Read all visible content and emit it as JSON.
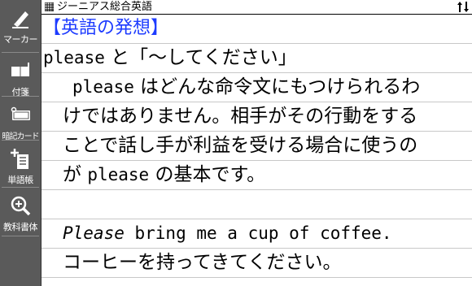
{
  "toolbar": {
    "items": [
      {
        "label": "マーカー",
        "icon": "marker-pen-icon"
      },
      {
        "label": "付箋",
        "icon": "sticky-note-icon"
      },
      {
        "label": "暗記カード",
        "icon": "flashcard-icon"
      },
      {
        "label": "単語帳",
        "icon": "wordbook-add-icon"
      },
      {
        "label": "教科書体",
        "icon": "zoom-icon"
      }
    ]
  },
  "title_bar": {
    "title": "ジーニアス総合英語"
  },
  "content": {
    "heading": "【英語の発想】",
    "line1_en": "please",
    "line1_ja": " と「～してください」",
    "line2_en": "please",
    "line2_ja": " はどんな命令文にもつけられるわ",
    "line3": "けではありません。相手がその行動をする",
    "line4": "ことで話し手が利益を受ける場合に使うの",
    "line5_ja1": "が ",
    "line5_en": "please",
    "line5_ja2": " の基本です。",
    "example_en_em": "Please",
    "example_en_rest": " bring me a cup of coffee.",
    "example_ja": "コーヒーを持ってきてください。"
  },
  "colors": {
    "toolbar_bg": "#5a5a5a",
    "heading": "#1e3cff",
    "rule": "#c8c8c8"
  }
}
